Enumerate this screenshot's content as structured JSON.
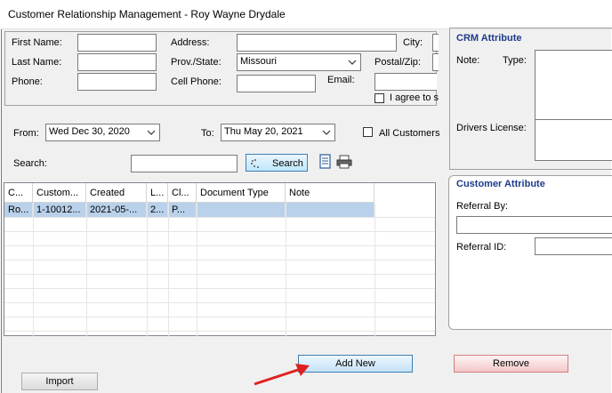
{
  "window": {
    "title": "Customer Relationship Management - Roy Wayne Drydale"
  },
  "customer_form": {
    "first_name_label": "First Name:",
    "last_name_label": "Last Name:",
    "phone_label": "Phone:",
    "address_label": "Address:",
    "prov_state_label": "Prov./State:",
    "prov_state_value": "Missouri",
    "cell_phone_label": "Cell Phone:",
    "email_label": "Email:",
    "city_label": "City:",
    "postal_zip_label": "Postal/Zip:",
    "agree_label": "I agree to s"
  },
  "filters": {
    "from_label": "From:",
    "from_value": "Wed Dec 30, 2020",
    "to_label": "To:",
    "to_value": "Thu  May 20, 2021",
    "all_customers_label": "All Customers",
    "search_label": "Search:",
    "search_button_label": "Search"
  },
  "grid": {
    "columns": [
      "C...",
      "Custom...",
      "Created",
      "L...",
      "Cl...",
      "Document Type",
      "Note"
    ],
    "rows": [
      [
        "Ro...",
        "1-10012...",
        "2021-05-...",
        "2...",
        "P...",
        "",
        ""
      ]
    ]
  },
  "crm_attribute": {
    "title": "CRM Attribute",
    "note_label": "Note:",
    "type_label": "Type:",
    "drivers_license_label": "Drivers License:"
  },
  "customer_attribute": {
    "title": "Customer Attribute",
    "referral_by_label": "Referral By:",
    "referral_id_label": "Referral ID:"
  },
  "buttons": {
    "add_new_label": "Add New",
    "remove_label": "Remove",
    "import_label": "Import"
  },
  "colors": {
    "selected_row": "#b9d1ea",
    "section_title": "#1f3b8a",
    "annotation_arrow": "#e02020"
  }
}
